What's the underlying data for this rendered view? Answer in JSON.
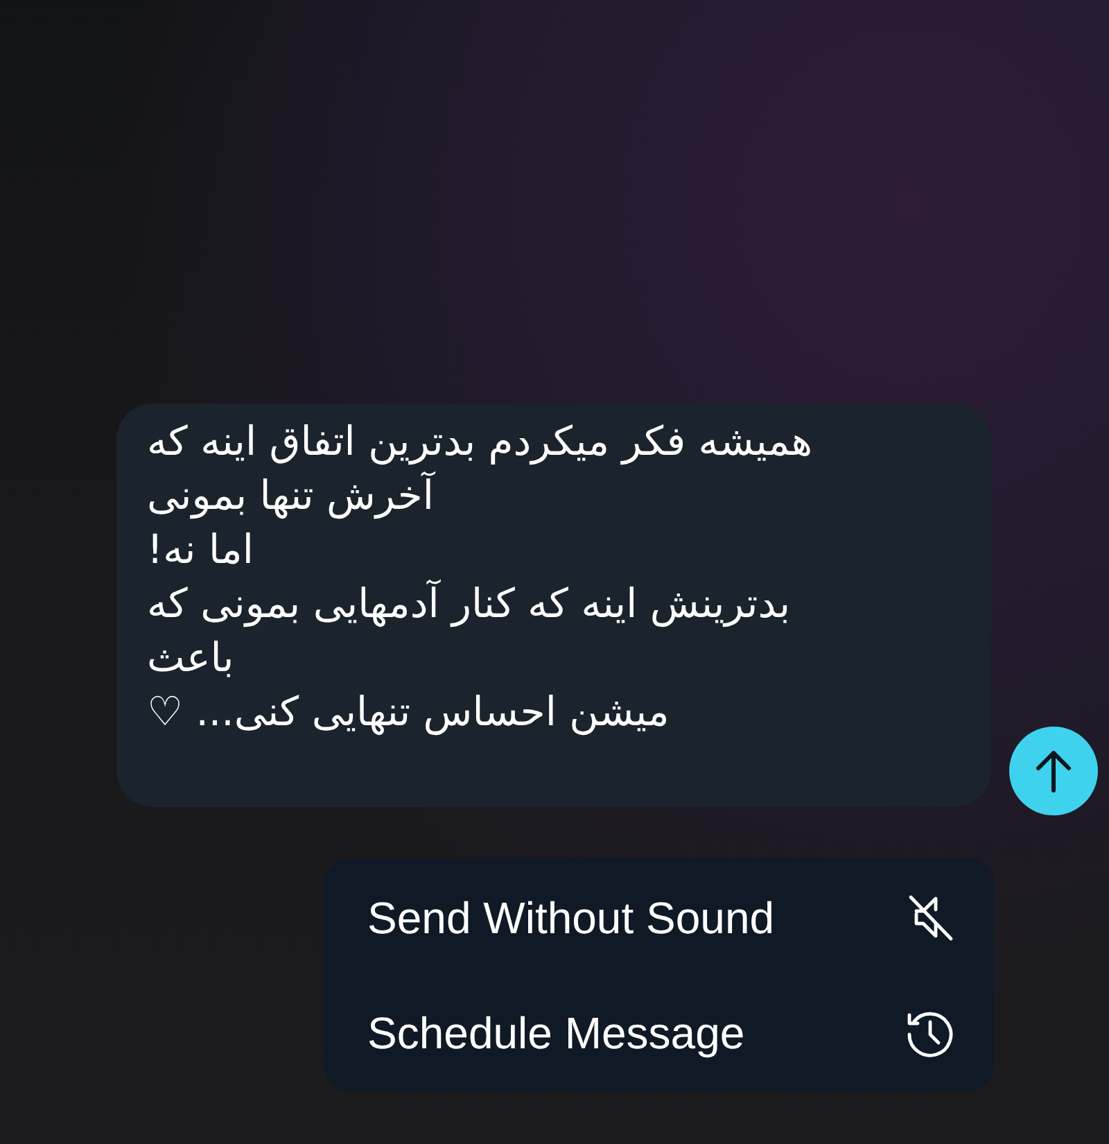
{
  "composer": {
    "message": "همیشه فکر میکردم بدترین اتفاق اینه که\nآخرش تنها بمونی\nاما نه!\nبدترینش اینه که کنار آدمهایی بمونی که\nباعث\nمیشن احساس تنهایی کنی... ♡"
  },
  "send_menu": {
    "items": [
      {
        "label": "Send Without Sound",
        "kind": "silent"
      },
      {
        "label": "Schedule Message",
        "kind": "schedule"
      }
    ]
  }
}
